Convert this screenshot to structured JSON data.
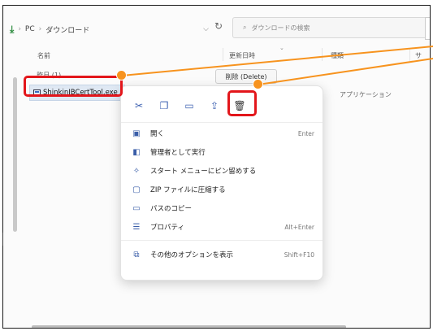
{
  "address": {
    "segments": [
      "PC",
      "ダウンロード"
    ]
  },
  "search": {
    "placeholder": "ダウンロードの検索"
  },
  "columns": {
    "name": "名前",
    "modified": "更新日時",
    "type": "種類",
    "size": "サ"
  },
  "group": {
    "label": "昨日 (1)"
  },
  "file": {
    "name": "ShinkinIBCertTool.exe",
    "type": "アプリケーション"
  },
  "tooltip": {
    "text": "削除 (Delete)"
  },
  "menu": {
    "icons": [
      "cut-icon",
      "copy-icon",
      "rename-icon",
      "share-icon",
      "delete-icon"
    ],
    "items": [
      {
        "label": "開く",
        "shortcut": "Enter"
      },
      {
        "label": "管理者として実行",
        "shortcut": ""
      },
      {
        "label": "スタート メニューにピン留めする",
        "shortcut": ""
      },
      {
        "label": "ZIP ファイルに圧縮する",
        "shortcut": ""
      },
      {
        "label": "パスのコピー",
        "shortcut": ""
      },
      {
        "label": "プロパティ",
        "shortcut": "Alt+Enter"
      },
      {
        "label": "その他のオプションを表示",
        "shortcut": "Shift+F10"
      }
    ]
  },
  "colors": {
    "highlight": "#e3161b",
    "callout": "#f7931e",
    "selection": "#dfe8f3"
  }
}
